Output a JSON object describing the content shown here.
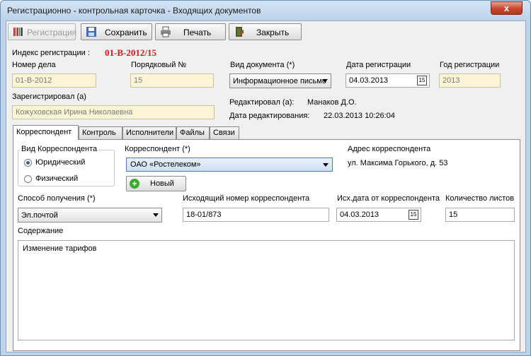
{
  "window": {
    "title": "Регистрационно - контрольная карточка - Входящих документов",
    "close_glyph": "x"
  },
  "toolbar": {
    "register_label": "Регистрация",
    "save_label": "Сохранить",
    "print_label": "Печать",
    "close_label": "Закрыть"
  },
  "header": {
    "reg_index_label": "Индекс регистрации :",
    "reg_index_value": "01-В-2012/15",
    "case_number_label": "Номер дела",
    "case_number_value": "01-В-2012",
    "serial_number_label": "Порядковый №",
    "serial_number_value": "15",
    "doc_type_label": "Вид документа (*)",
    "doc_type_value": "Информационное письмо",
    "reg_date_label": "Дата регистрации",
    "reg_date_value": "04.03.2013",
    "reg_year_label": "Год регистрации",
    "reg_year_value": "2013",
    "registered_by_label": "Зарегистрировал (а)",
    "registered_by_value": "Кожуховская Ирина Николаевна",
    "edited_by_label": "Редактировал (а):",
    "edited_by_value": "Манаков Д.О.",
    "edit_date_label": "Дата редактирования:",
    "edit_date_value": "22.03.2013 10:26:04",
    "datepicker_glyph": "15"
  },
  "tabs": [
    "Корреспондент",
    "Контроль",
    "Исполнители",
    "Файлы",
    "Связи"
  ],
  "correspondent": {
    "kind_group_title": "Вид Корреспондента",
    "kind_legal": "Юридический",
    "kind_physical": "Физический",
    "correspondent_label": "Корреспондент (*)",
    "correspondent_value": "ОАО «Ростелеком»",
    "new_button_label": "Новый",
    "address_label": "Адрес корреспондента",
    "address_value": "ул. Максима Горького, д. 53",
    "receive_method_label": "Способ получения (*)",
    "receive_method_value": "Эл.почтой",
    "outgoing_number_label": "Исходящий номер корреспондента",
    "outgoing_number_value": "18-01/873",
    "outgoing_date_label": "Исх.дата от корреспондента",
    "outgoing_date_value": "04.03.2013",
    "sheets_label": "Количество листов",
    "sheets_value": "15",
    "content_label": "Содержание",
    "content_value": "Изменение тарифов"
  },
  "colors": {
    "accent_red": "#e0141c",
    "readonly_bg": "#fbf5d5",
    "corr_combo_border": "#4a7bbd"
  },
  "icons": {
    "register": "barcode-icon",
    "save": "floppy-disk-icon",
    "print": "printer-icon",
    "close": "exit-door-icon",
    "new": "plus-circle-icon"
  }
}
